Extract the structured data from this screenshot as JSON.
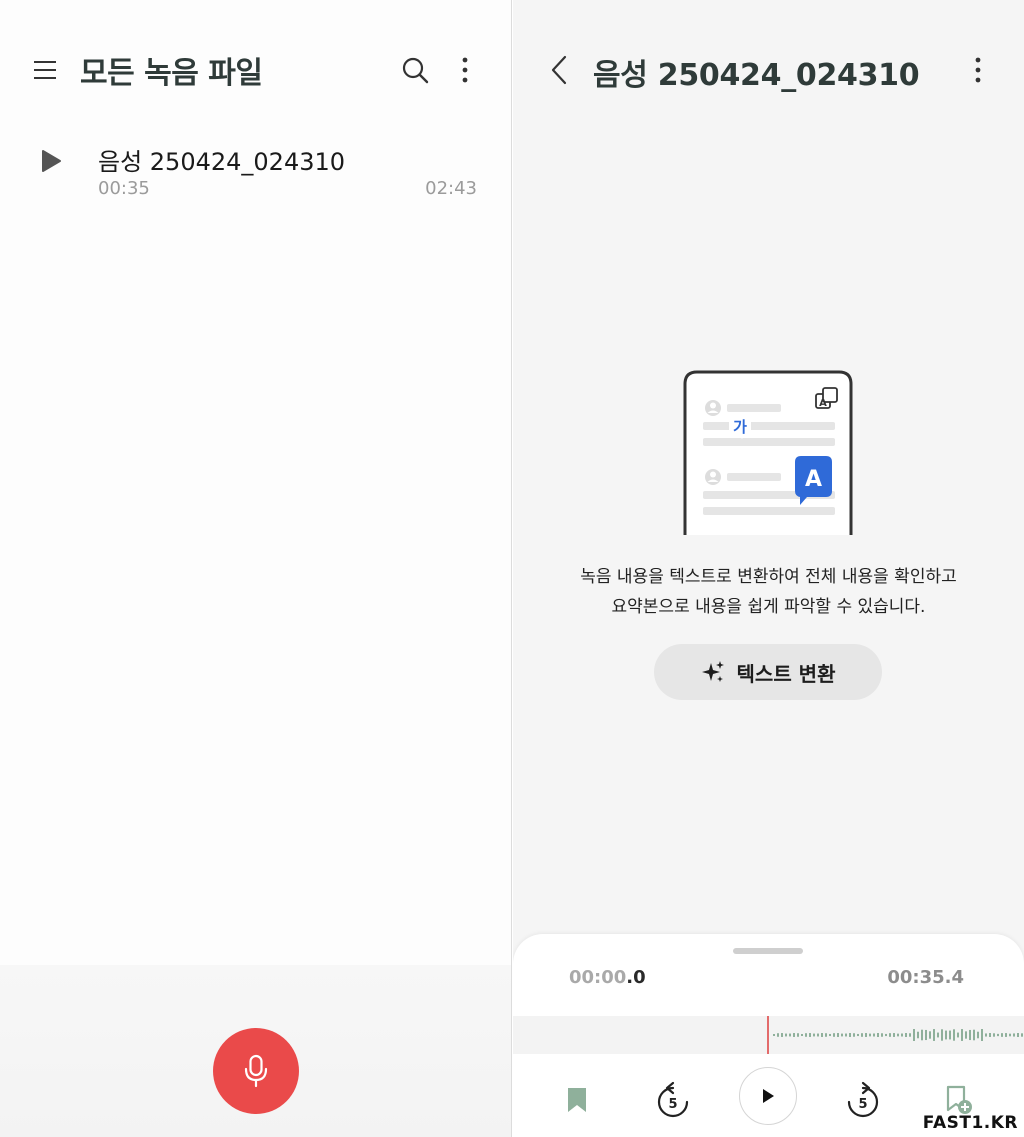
{
  "left": {
    "title": "모든 녹음 파일",
    "recordings": [
      {
        "name": "음성 250424_024310",
        "duration": "00:35",
        "time": "02:43"
      }
    ]
  },
  "right": {
    "title": "음성 250424_024310",
    "illustration": {
      "bubble_ko": "가",
      "bubble_en": "A"
    },
    "description": [
      "녹음 내용을 텍스트로 변환하여 전체 내용을 확인하고",
      "요약본으로 내용을 쉽게 파악할 수 있습니다."
    ],
    "convert_button_label": "텍스트 변환",
    "player": {
      "start_time_main": "00:00",
      "start_time_decimal": ".0",
      "end_time": "00:35.4",
      "skip_back_seconds": "5",
      "skip_forward_seconds": "5"
    }
  },
  "watermark": "FAST1.KR",
  "colors": {
    "title_text": "#2f3b39",
    "record_button": "#ea4a4a",
    "bookmark_green": "#8fb09b",
    "wave_teal": "#2ecfb8",
    "wave_blue": "#3b7ce0",
    "playhead": "#e36b6b"
  }
}
